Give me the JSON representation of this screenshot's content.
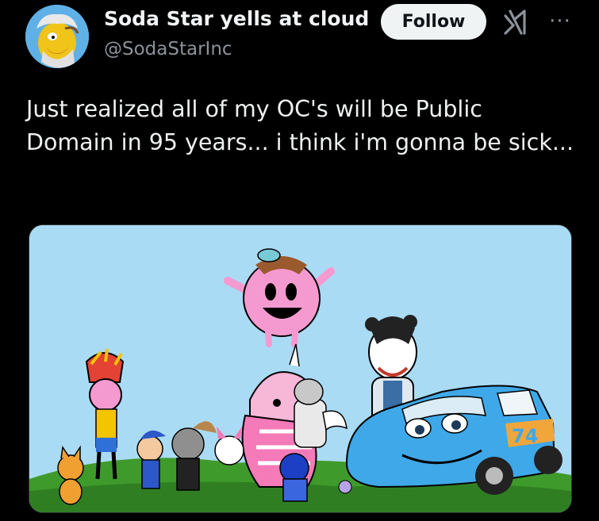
{
  "author": {
    "display_name": "Soda Star yells at cloud",
    "handle": "@SodaStarInc",
    "avatar_icon": "cartoon-old-man-avatar"
  },
  "actions": {
    "follow_label": "Follow",
    "grok_icon": "grok-icon",
    "more_icon": "more-options-icon"
  },
  "post": {
    "text": "Just realized all of my OC's will be Public Domain in 95 years... i think i'm gonna be sick..."
  },
  "media": {
    "description_icon": "cartoon-characters-group-image",
    "car_number": "74"
  },
  "colors": {
    "background": "#000000",
    "text": "#e7e9ea",
    "secondary": "#71767b",
    "follow_bg": "#eff3f4",
    "sky": "#a9dcf4",
    "grass": "#3f9a2c"
  }
}
